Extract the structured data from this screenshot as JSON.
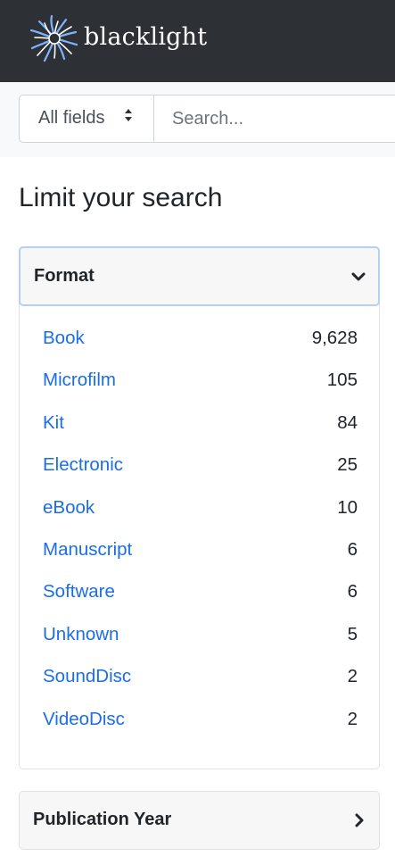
{
  "navbar": {
    "brand": "blacklight",
    "logo_icon": "sunburst-logo-icon",
    "background": "#2d3034"
  },
  "search": {
    "field_selected": "All fields",
    "field_arrows": "⬍",
    "placeholder": "Search..."
  },
  "sidebar": {
    "heading": "Limit your search",
    "facets": [
      {
        "label": "Format",
        "expanded": true,
        "icon": "chevron-down-icon",
        "items": [
          {
            "label": "Book",
            "count": "9,628"
          },
          {
            "label": "Microfilm",
            "count": "105"
          },
          {
            "label": "Kit",
            "count": "84"
          },
          {
            "label": "Electronic",
            "count": "25"
          },
          {
            "label": "eBook",
            "count": "10"
          },
          {
            "label": "Manuscript",
            "count": "6"
          },
          {
            "label": "Software",
            "count": "6"
          },
          {
            "label": "Unknown",
            "count": "5"
          },
          {
            "label": "SoundDisc",
            "count": "2"
          },
          {
            "label": "VideoDisc",
            "count": "2"
          }
        ]
      },
      {
        "label": "Publication Year",
        "expanded": false,
        "icon": "chevron-right-icon"
      }
    ]
  },
  "colors": {
    "link": "#1a6ee6",
    "focus_border": "#b6d0f5"
  }
}
